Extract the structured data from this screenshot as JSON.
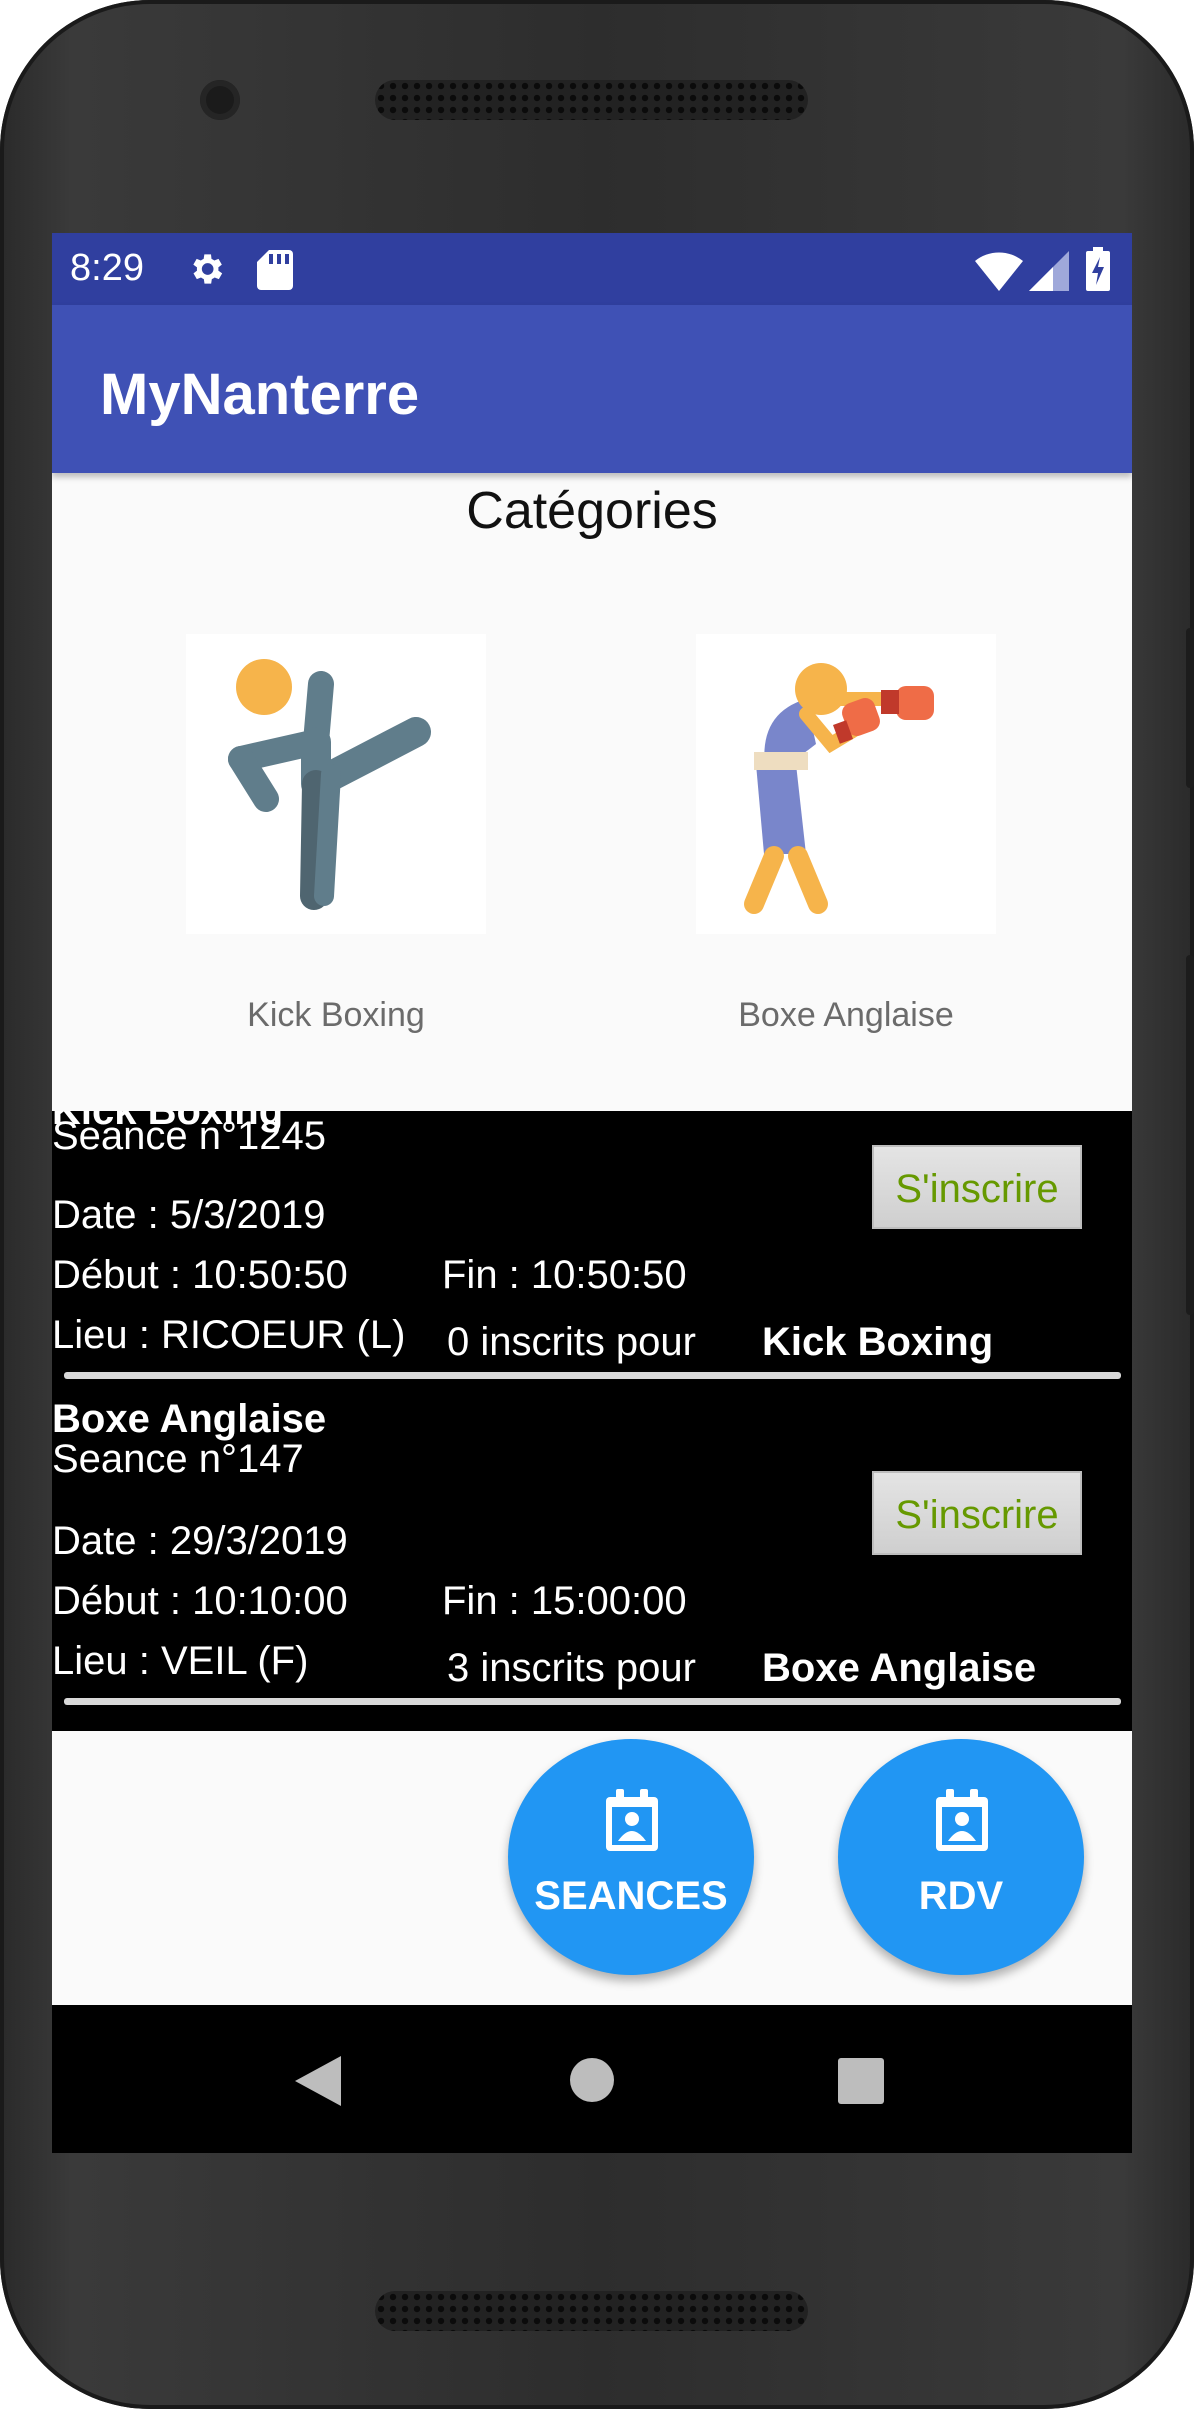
{
  "status_bar": {
    "time": "8:29",
    "icons": [
      "gear-icon",
      "sd-card-icon",
      "wifi-icon",
      "signal-icon",
      "battery-charging-icon"
    ],
    "color": "#303f9f"
  },
  "app_bar": {
    "title": "MyNanterre",
    "color": "#3f51b5"
  },
  "categories": {
    "title": "Catégories",
    "items": [
      {
        "label": "Kick Boxing",
        "icon": "kick-boxing-icon"
      },
      {
        "label": "Boxe Anglaise",
        "icon": "boxing-icon"
      }
    ]
  },
  "sessions": [
    {
      "category": "Kick Boxing",
      "seance": "Seance n°1245",
      "date": "Date : 5/3/2019",
      "debut": "Début : 10:50:50",
      "fin": "Fin : 10:50:50",
      "lieu": "Lieu : RICOEUR (L)",
      "inscrits": "0 inscrits pour",
      "inscrits_category": "Kick Boxing",
      "button": "S'inscrire"
    },
    {
      "category": "Boxe Anglaise",
      "seance": "Seance n°147",
      "date": "Date : 29/3/2019",
      "debut": "Début : 10:10:00",
      "fin": "Fin : 15:00:00",
      "lieu": "Lieu : VEIL (F)",
      "inscrits": "3 inscrits pour",
      "inscrits_category": "Boxe Anglaise",
      "button": "S'inscrire"
    }
  ],
  "fabs": [
    {
      "label": "SEANCES",
      "icon": "calendar-contact-icon"
    },
    {
      "label": "RDV",
      "icon": "calendar-contact-icon"
    }
  ],
  "fab_color": "#2196f3",
  "button_text_color": "#669900",
  "nav_bar": {
    "buttons": [
      "back-icon",
      "home-icon",
      "recents-icon"
    ]
  }
}
